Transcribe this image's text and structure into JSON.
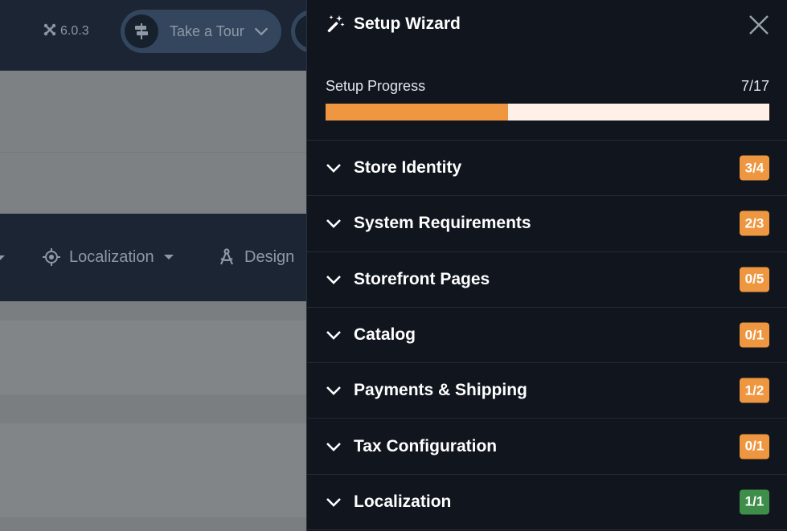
{
  "background": {
    "version": "6.0.3",
    "tour_button_label": "Take a Tour",
    "nav": {
      "localization_label": "Localization",
      "design_label": "Design"
    }
  },
  "wizard": {
    "title": "Setup Wizard",
    "progress": {
      "label": "Setup Progress",
      "count_text": "7/17",
      "completed": 7,
      "total": 17
    },
    "sections": [
      {
        "label": "Store Identity",
        "badge": "3/4",
        "badge_color": "#ee9640"
      },
      {
        "label": "System Requirements",
        "badge": "2/3",
        "badge_color": "#ee9640"
      },
      {
        "label": "Storefront Pages",
        "badge": "0/5",
        "badge_color": "#ee9640"
      },
      {
        "label": "Catalog",
        "badge": "0/1",
        "badge_color": "#ee9640"
      },
      {
        "label": "Payments & Shipping",
        "badge": "1/2",
        "badge_color": "#ee9640"
      },
      {
        "label": "Tax Configuration",
        "badge": "0/1",
        "badge_color": "#ee9640"
      },
      {
        "label": "Localization",
        "badge": "1/1",
        "badge_color": "#3e8e4a"
      }
    ]
  },
  "colors": {
    "accent": "#ee9640",
    "success": "#3e8e4a",
    "panel_bg": "#10151e",
    "topbar_bg": "#1b2533"
  }
}
